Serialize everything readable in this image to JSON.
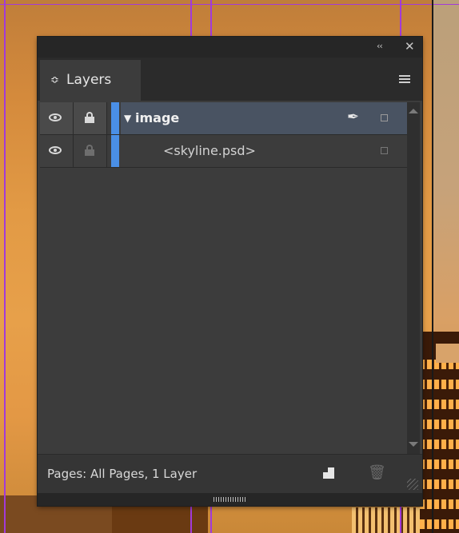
{
  "panel": {
    "collapse_glyph": "‹‹",
    "close_glyph": "✕",
    "tab": {
      "icon_glyph": "≎",
      "label": "Layers"
    },
    "menu_icon": "panel-menu-icon"
  },
  "layers": [
    {
      "name": "image",
      "visible": true,
      "locked": true,
      "color": "#4a8fe6",
      "expanded": true,
      "selected": true
    },
    {
      "name": "<skyline.psd>",
      "visible": true,
      "locked": false,
      "color": "#4a8fe6",
      "child": true
    }
  ],
  "footer": {
    "status": "Pages: All Pages, 1 Layer",
    "new_layer_icon": "new-layer-icon",
    "delete_icon": "trash-icon"
  },
  "colors": {
    "panel_bg": "#3c3c3c",
    "selected_row": "#495362",
    "layer_color": "#4a8fe6",
    "guide": "#a23ad9"
  }
}
